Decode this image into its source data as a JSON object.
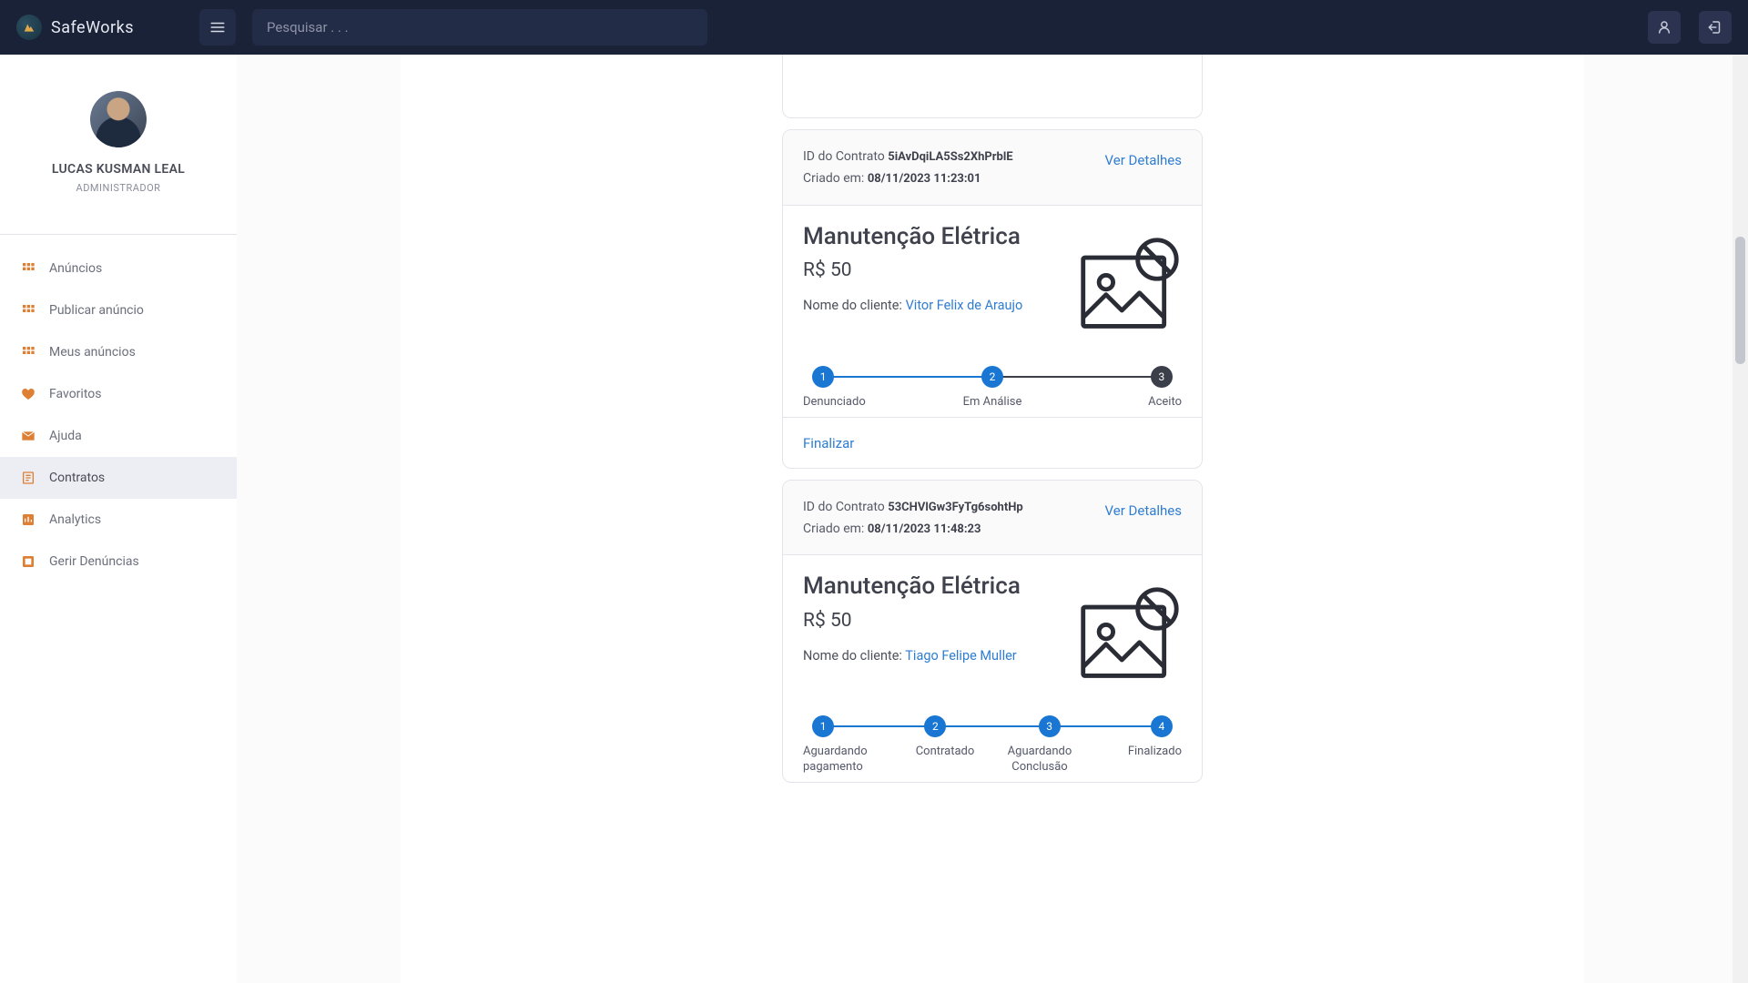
{
  "brand": {
    "name": "SafeWorks"
  },
  "search": {
    "placeholder": "Pesquisar . . ."
  },
  "profile": {
    "name": "LUCAS KUSMAN LEAL",
    "role": "ADMINISTRADOR"
  },
  "nav": {
    "items": [
      {
        "key": "anuncios",
        "label": "Anúncios",
        "icon": "grid"
      },
      {
        "key": "publicar",
        "label": "Publicar anúncio",
        "icon": "grid"
      },
      {
        "key": "meus-anuncios",
        "label": "Meus anúncios",
        "icon": "grid"
      },
      {
        "key": "favoritos",
        "label": "Favoritos",
        "icon": "heart"
      },
      {
        "key": "ajuda",
        "label": "Ajuda",
        "icon": "mail"
      },
      {
        "key": "contratos",
        "label": "Contratos",
        "icon": "doc",
        "active": true
      },
      {
        "key": "analytics",
        "label": "Analytics",
        "icon": "chart"
      },
      {
        "key": "gerir-denuncias",
        "label": "Gerir Denúncias",
        "icon": "flag"
      }
    ]
  },
  "labels": {
    "contract_id": "ID do Contrato",
    "created_at": "Criado em:",
    "details": "Ver Detalhes",
    "client_name": "Nome do cliente:",
    "finalize": "Finalizar"
  },
  "contracts": [
    {
      "id": "5iAvDqiLA5Ss2XhPrblE",
      "created": "08/11/2023 11:23:01",
      "service": "Manutenção Elétrica",
      "price": "R$ 50",
      "client": "Vitor Felix de Araujo",
      "steps": [
        "Denunciado",
        "Em Análise",
        "Aceito"
      ],
      "active_step_index": 1,
      "show_finalize": true
    },
    {
      "id": "53CHVlGw3FyTg6sohtHp",
      "created": "08/11/2023 11:48:23",
      "service": "Manutenção Elétrica",
      "price": "R$ 50",
      "client": "Tiago Felipe Muller",
      "steps": [
        "Aguardando pagamento",
        "Contratado",
        "Aguardando Conclusão",
        "Finalizado"
      ],
      "active_step_index": 3,
      "show_finalize": false
    }
  ]
}
